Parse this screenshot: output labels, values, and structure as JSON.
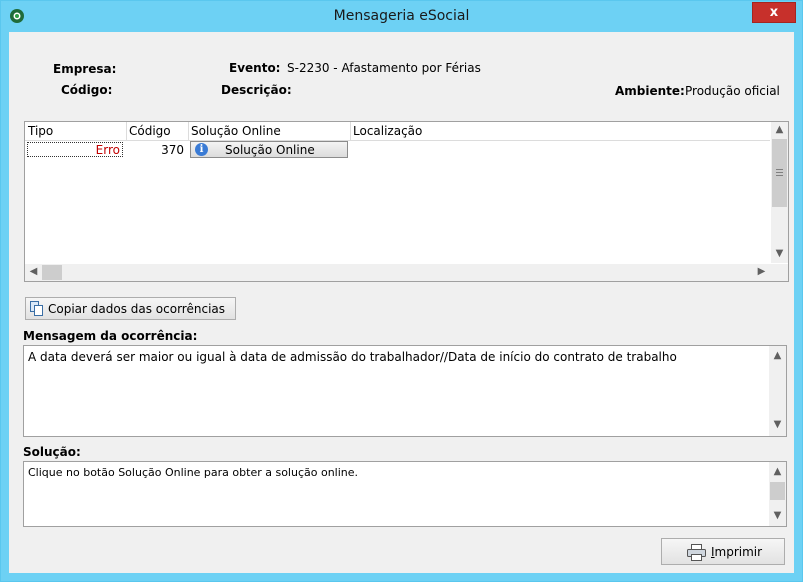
{
  "window": {
    "title": "Mensageria eSocial",
    "close_glyph": "x"
  },
  "header": {
    "empresa_label": "Empresa:",
    "evento_label": "Evento:",
    "evento_value": "S-2230 - Afastamento por Férias",
    "codigo_label": "Código:",
    "descricao_label": "Descrição:",
    "ambiente_label": "Ambiente:",
    "ambiente_value": "Produção oficial"
  },
  "grid": {
    "columns": [
      "Tipo",
      "Código",
      "Solução Online",
      "Localização"
    ],
    "rows": [
      {
        "tipo": "Erro",
        "codigo": "370",
        "solucao_button": "Solução Online",
        "localizacao": ""
      }
    ]
  },
  "copy_button": {
    "label": "Copiar dados das ocorrências"
  },
  "mensagem": {
    "label": "Mensagem da ocorrência:",
    "text": "A data deverá ser maior ou igual à data de admissão do trabalhador//Data de início do contrato de trabalho"
  },
  "solucao": {
    "label": "Solução:",
    "text": "Clique no botão Solução Online para obter a solução online."
  },
  "print_button": {
    "label_underlined": "I",
    "label_rest": "mprimir"
  },
  "colors": {
    "title_bar": "#6dd1f4",
    "error_text": "#c00000",
    "close_button": "#c7302b"
  },
  "icons": {
    "app": "esocial-logo-icon",
    "info": "info-icon",
    "copy": "copy-documents-icon",
    "print": "printer-icon"
  }
}
